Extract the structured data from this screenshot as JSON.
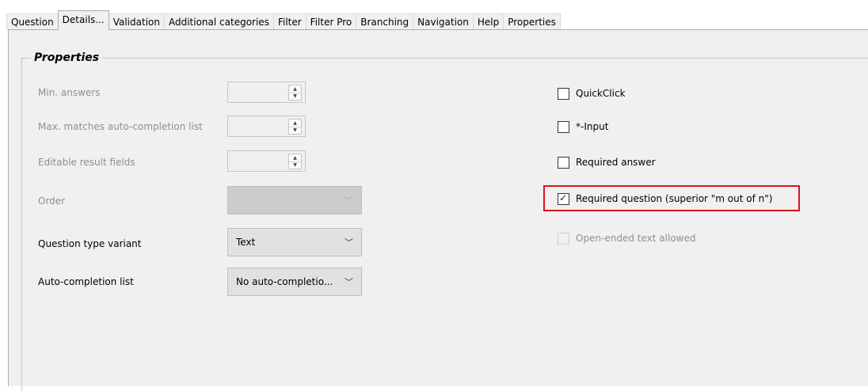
{
  "tabs": [
    {
      "label": "Question"
    },
    {
      "label": "Details..."
    },
    {
      "label": "Validation"
    },
    {
      "label": "Additional categories"
    },
    {
      "label": "Filter"
    },
    {
      "label": "Filter Pro"
    },
    {
      "label": "Branching"
    },
    {
      "label": "Navigation"
    },
    {
      "label": "Help"
    },
    {
      "label": "Properties"
    }
  ],
  "active_tab": "Details...",
  "group": {
    "title": "Properties"
  },
  "fields": {
    "min_answers": {
      "label": "Min. answers",
      "value": ""
    },
    "max_matches": {
      "label": "Max. matches auto-completion list",
      "value": ""
    },
    "editable_fields": {
      "label": "Editable result fields",
      "value": ""
    },
    "order": {
      "label": "Order",
      "value": ""
    },
    "question_type_variant": {
      "label": "Question type variant",
      "value": "Text"
    },
    "auto_completion_list": {
      "label": "Auto-completion list",
      "value": "No auto-completio..."
    }
  },
  "checkboxes": {
    "quickclick": {
      "label": "QuickClick",
      "checked": false
    },
    "star_input": {
      "label": "*-Input",
      "checked": false
    },
    "required_answer": {
      "label": "Required answer",
      "checked": false
    },
    "required_question": {
      "label": "Required question (superior \"m out of n\")",
      "checked": true
    },
    "open_ended_text": {
      "label": "Open-ended text allowed",
      "checked": false
    }
  },
  "icons": {
    "spin_up": "▲",
    "spin_down": "▼",
    "chevron": "﹀",
    "check": "✓"
  },
  "colors": {
    "highlight": "#d9141e",
    "panel_bg": "#f0f0f0"
  }
}
